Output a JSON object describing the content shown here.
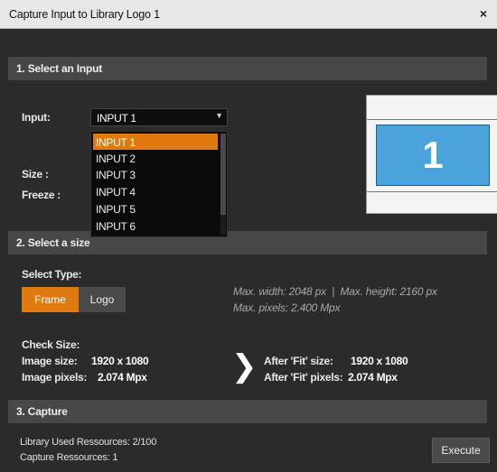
{
  "window": {
    "title": "Capture Input to Library Logo 1",
    "close_glyph": "×"
  },
  "section1": {
    "header": "1. Select an Input",
    "input_label": "Input:",
    "input_value": "INPUT 1",
    "dropdown_options": [
      "INPUT 1",
      "INPUT 2",
      "INPUT 3",
      "INPUT 4",
      "INPUT 5",
      "INPUT 6"
    ],
    "selected_option": "INPUT 1",
    "size_label": "Size :",
    "freeze_label": "Freeze :",
    "preview_number": "1"
  },
  "section2": {
    "header": "2. Select a size",
    "select_type_label": "Select Type:",
    "type_options": [
      {
        "label": "Frame",
        "active": true
      },
      {
        "label": "Logo",
        "active": false
      }
    ],
    "max_dims": "Max. width: 2048 px  |  Max. height: 2160 px",
    "max_pixels": "Max. pixels: 2.400 Mpx",
    "check_size_label": "Check Size:",
    "image_size_label": "Image size:",
    "image_size_value": "1920 x 1080",
    "image_pixels_label": "Image pixels:",
    "image_pixels_value": "2.074 Mpx",
    "arrow_glyph": "❯",
    "after_fit_size_label": "After 'Fit' size:",
    "after_fit_size_value": "1920 x 1080",
    "after_fit_pixels_label": "After 'Fit' pixels:",
    "after_fit_pixels_value": "2.074 Mpx"
  },
  "section3": {
    "header": "3. Capture",
    "library_resources": "Library Used Ressources: 2/100",
    "capture_resources": "Capture Ressources: 1",
    "execute_label": "Execute"
  },
  "colors": {
    "accent_orange": "#e07a0e",
    "preview_blue": "#4aa3db",
    "panel_bg": "#2b2b2b",
    "header_bg": "#474747"
  }
}
